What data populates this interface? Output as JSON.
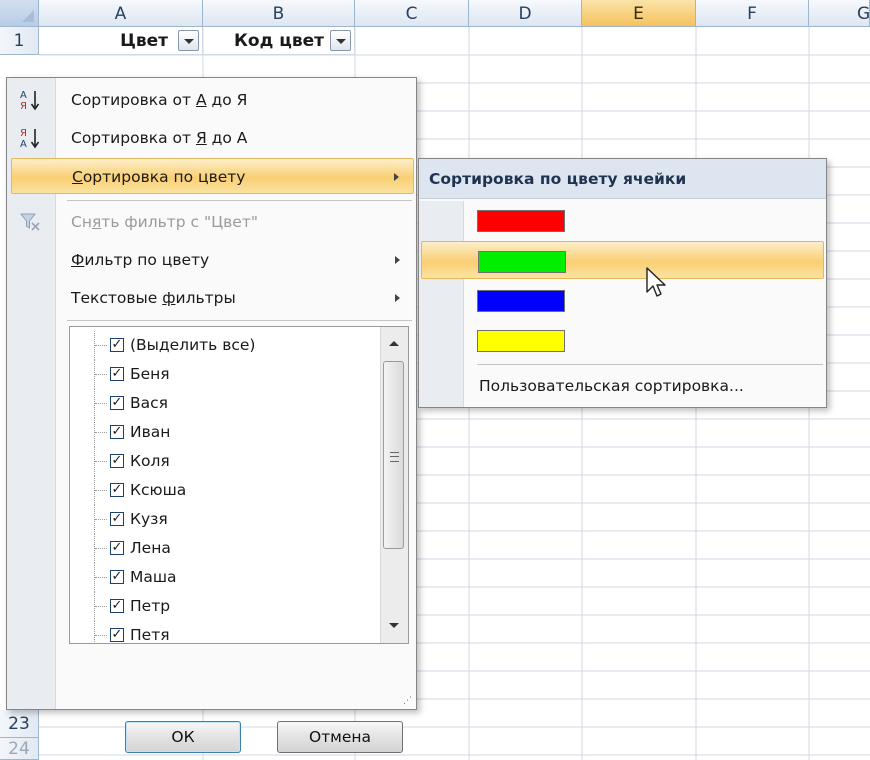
{
  "sheet": {
    "columns": [
      "A",
      "B",
      "C",
      "D",
      "E",
      "F",
      "G"
    ],
    "selected_column": "E",
    "row_numbers": [
      "1",
      "23",
      "24"
    ],
    "header_cells": [
      "Цвет",
      "Код цвет"
    ]
  },
  "filter_menu": {
    "items": [
      {
        "prefix": "Сортировка от ",
        "key": "А",
        "suffix": " до Я",
        "icon": "sort-az-icon"
      },
      {
        "prefix": "Сортировка от ",
        "key": "Я",
        "suffix": " до А",
        "icon": "sort-za-icon"
      },
      {
        "prefix": "",
        "key": "С",
        "suffix": "ортировка по цвету",
        "icon": ""
      },
      {
        "prefix": "Сн",
        "key": "я",
        "suffix": "ть фильтр с \"Цвет\"",
        "icon": "clear-filter-icon"
      },
      {
        "prefix": "",
        "key": "Ф",
        "suffix": "ильтр по цвету",
        "icon": ""
      },
      {
        "prefix": "Текстовые ",
        "key": "ф",
        "suffix": "ильтры",
        "icon": ""
      }
    ],
    "list": [
      "(Выделить все)",
      "Беня",
      "Вася",
      "Иван",
      "Коля",
      "Ксюша",
      "Кузя",
      "Лена",
      "Маша",
      "Петр",
      "Петя"
    ],
    "ok_label": "ОК",
    "cancel_label": "Отмена"
  },
  "color_submenu": {
    "title": "Сортировка по цвету ячейки",
    "swatches": [
      "#ff0000",
      "#00ee00",
      "#0000ff",
      "#ffff00"
    ],
    "highlighted_index": 1,
    "custom_sort": "Пользовательская сортировка..."
  }
}
